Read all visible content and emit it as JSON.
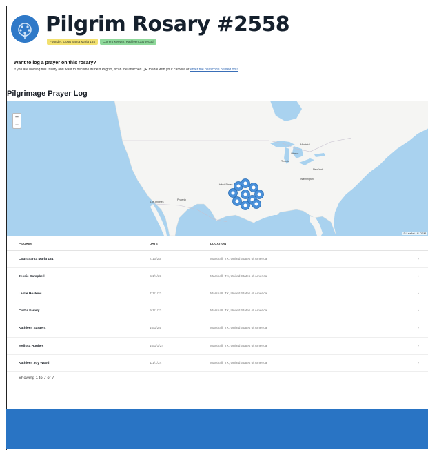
{
  "page": {
    "title": "Pilgrim Rosary #2558",
    "badges": {
      "founder": "Founder: Court Santa Maria 184",
      "current": "Current Keeper: Kathleen Joy Wood"
    }
  },
  "prompt": {
    "title": "Want to log a prayer on this rosary?",
    "text": "If you are holding this rosary and want to become its next Pilgrim, scan the attached QR medal with your camera or",
    "link": "enter the passcode printed on it"
  },
  "section": {
    "title": "Pilgrimage Prayer Log"
  },
  "map": {
    "zoom_in": "+",
    "zoom_out": "−",
    "attribution": "© Leaflet | © OSM",
    "labels": {
      "ottawa": "Ottawa",
      "montreal": "Montréal",
      "toronto": "Toronto",
      "new_york": "New York",
      "washington": "Washington",
      "los_angeles": "Los Angeles",
      "phoenix": "Phoenix",
      "united_states": "United States"
    },
    "marker_color": "#4a90d9"
  },
  "table": {
    "headers": {
      "name": "PILGRIM",
      "date": "DATE",
      "location": "LOCATION"
    },
    "rows": [
      {
        "name": "Court Santa Maria 184",
        "date": "7/10/23",
        "location": "Marshall, TX, United States of America"
      },
      {
        "name": "Jessie Campbell",
        "date": "2/1/1/23",
        "location": "Marshall, TX, United States of America"
      },
      {
        "name": "Leslie Hoskins",
        "date": "7/1/1/23",
        "location": "Marshall, TX, United States of America"
      },
      {
        "name": "Curtis Family",
        "date": "9/1/1/23",
        "location": "Marshall, TX, United States of America"
      },
      {
        "name": "Kathleen Sargent",
        "date": "10/1/24",
        "location": "Marshall, TX, United States of America"
      },
      {
        "name": "Melissa Hughes",
        "date": "10/1/1/24",
        "location": "Marshall, TX, United States of America"
      },
      {
        "name": "Kathleen Joy Wood",
        "date": "1/1/1/24",
        "location": "Marshall, TX, United States of America"
      }
    ],
    "chevron": "›"
  },
  "footer": {
    "count": "Showing 1 to 7 of 7"
  },
  "colors": {
    "brand": "#2f79c8",
    "footer": "#2974c4",
    "water": "#a9d2ef",
    "land": "#f5f5f3"
  }
}
